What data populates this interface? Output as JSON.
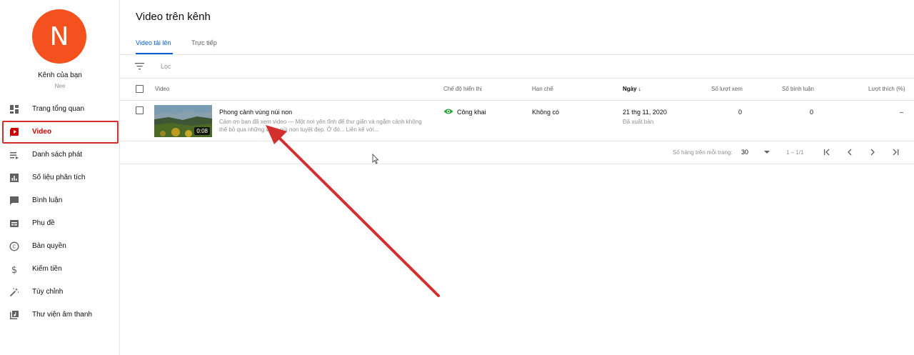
{
  "channel": {
    "avatar_letter": "N",
    "title": "Kênh của bạn",
    "subtitle": "Nee"
  },
  "sidebar": {
    "items": [
      {
        "label": "Trang tổng quan",
        "icon": "dashboard-icon"
      },
      {
        "label": "Video",
        "icon": "video-icon",
        "active": true
      },
      {
        "label": "Danh sách phát",
        "icon": "playlist-icon"
      },
      {
        "label": "Số liệu phân tích",
        "icon": "analytics-icon"
      },
      {
        "label": "Bình luận",
        "icon": "comment-icon"
      },
      {
        "label": "Phụ đề",
        "icon": "subtitles-icon"
      },
      {
        "label": "Bản quyền",
        "icon": "copyright-icon"
      },
      {
        "label": "Kiếm tiền",
        "icon": "dollar-icon"
      },
      {
        "label": "Tùy chỉnh",
        "icon": "magic-wand-icon"
      },
      {
        "label": "Thư viện âm thanh",
        "icon": "audio-library-icon"
      }
    ]
  },
  "main": {
    "title": "Video trên kênh",
    "tabs": [
      {
        "label": "Video tải lên",
        "active": true
      },
      {
        "label": "Trực tiếp"
      }
    ],
    "filter_label": "Lọc",
    "columns": {
      "video": "Video",
      "visibility": "Chế độ hiển thị",
      "restrictions": "Hạn chế",
      "date": "Ngày",
      "views": "Số lượt xem",
      "comments": "Số bình luận",
      "likes": "Lượt thích (%)"
    },
    "rows": [
      {
        "title": "Phong cảnh vùng núi non",
        "description": "Cảm ơn bạn đã xem video — Một nơi yên tĩnh để thư giãn và ngắm cảnh không thể bỏ qua những vùng núi non tuyệt đẹp. Ở đó... Liên kế với...",
        "duration": "0:08",
        "visibility": "Công khai",
        "restrictions": "Không có",
        "date": "21 thg 11, 2020",
        "date_status": "Đã xuất bản",
        "views": "0",
        "comments": "0",
        "likes": "–"
      }
    ],
    "pagination": {
      "rows_per_page_label": "Số hàng trên mỗi trang:",
      "rows_per_page": "30",
      "range": "1 – 1/1"
    }
  },
  "colors": {
    "accent": "#065fd4",
    "avatar": "#f4511e",
    "highlight": "#d32f2f",
    "active_nav": "#cc0000",
    "public_eye": "#2ba640"
  }
}
